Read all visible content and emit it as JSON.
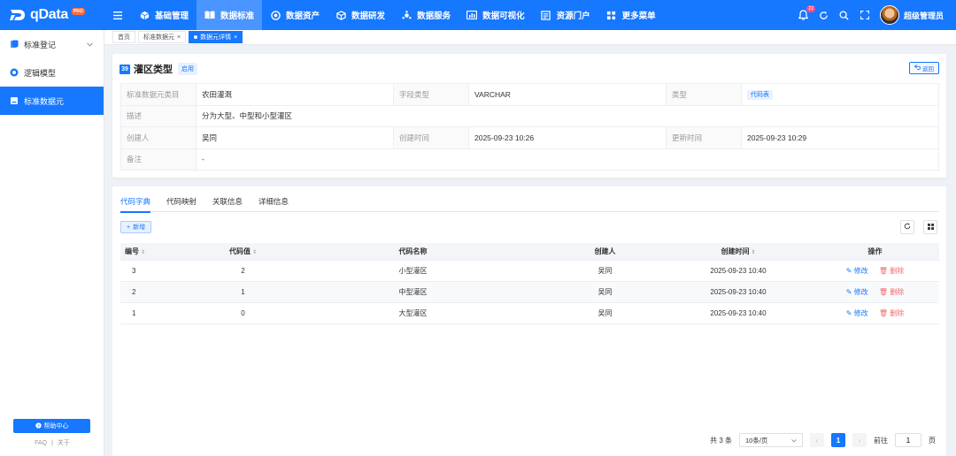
{
  "brand": {
    "name": "qData",
    "badge": "PRO"
  },
  "topnav": [
    {
      "label": "基础管理",
      "icon": "cube-icon",
      "active": false
    },
    {
      "label": "数据标准",
      "icon": "book-icon",
      "active": true
    },
    {
      "label": "数据资产",
      "icon": "target-icon",
      "active": false
    },
    {
      "label": "数据研发",
      "icon": "box-icon",
      "active": false
    },
    {
      "label": "数据服务",
      "icon": "service-icon",
      "active": false
    },
    {
      "label": "数据可视化",
      "icon": "chart-icon",
      "active": false
    },
    {
      "label": "资源门户",
      "icon": "portal-icon",
      "active": false
    },
    {
      "label": "更多菜单",
      "icon": "grid-icon",
      "active": false
    }
  ],
  "notifications": {
    "count": "22"
  },
  "user": {
    "name": "超级管理员"
  },
  "sidebar": {
    "items": [
      {
        "label": "标准登记",
        "icon": "register-icon",
        "has_children": true
      },
      {
        "label": "逻辑模型",
        "icon": "model-icon",
        "has_children": false
      },
      {
        "label": "标准数据元",
        "icon": "element-icon",
        "has_children": false,
        "active": true
      }
    ],
    "help_label": "帮助中心",
    "footer_links": [
      "FAQ",
      "关于"
    ]
  },
  "page_tabs": [
    {
      "label": "首页",
      "closable": false
    },
    {
      "label": "标准数据元",
      "closable": true
    },
    {
      "label": "数据元详情",
      "closable": true,
      "active": true
    }
  ],
  "detail": {
    "id": "39",
    "title": "灌区类型",
    "status": "启用",
    "back_label": "返回",
    "fields": {
      "category_label": "标准数据元类目",
      "category": "农田灌溉",
      "field_type_label": "字段类型",
      "field_type": "VARCHAR",
      "type_label": "类型",
      "type": "代码表",
      "description_label": "描述",
      "description": "分为大型、中型和小型灌区",
      "creator_label": "创建人",
      "creator": "吴同",
      "create_time_label": "创建时间",
      "create_time": "2025-09-23 10:26",
      "update_time_label": "更新时间",
      "update_time": "2025-09-23 10:29",
      "remark_label": "备注",
      "remark": "-"
    }
  },
  "subtabs": [
    {
      "label": "代码字典",
      "active": true
    },
    {
      "label": "代码映射",
      "active": false
    },
    {
      "label": "关联信息",
      "active": false
    },
    {
      "label": "详细信息",
      "active": false
    }
  ],
  "add_label": "新增",
  "table": {
    "columns": [
      "编号",
      "代码值",
      "代码名称",
      "创建人",
      "创建时间",
      "操作"
    ],
    "edit_label": "修改",
    "delete_label": "删除",
    "rows": [
      {
        "id": "3",
        "code": "2",
        "name": "小型灌区",
        "creator": "吴同",
        "created": "2025-09-23 10:40"
      },
      {
        "id": "2",
        "code": "1",
        "name": "中型灌区",
        "creator": "吴同",
        "created": "2025-09-23 10:40"
      },
      {
        "id": "1",
        "code": "0",
        "name": "大型灌区",
        "creator": "吴同",
        "created": "2025-09-23 10:40"
      }
    ]
  },
  "pagination": {
    "total_text": "共 3 条",
    "page_size": "10条/页",
    "current_page": "1",
    "goto_label": "前往",
    "goto_value": "1",
    "page_suffix": "页"
  },
  "colors": {
    "primary": "#1677ff",
    "danger": "#f56c6c"
  }
}
